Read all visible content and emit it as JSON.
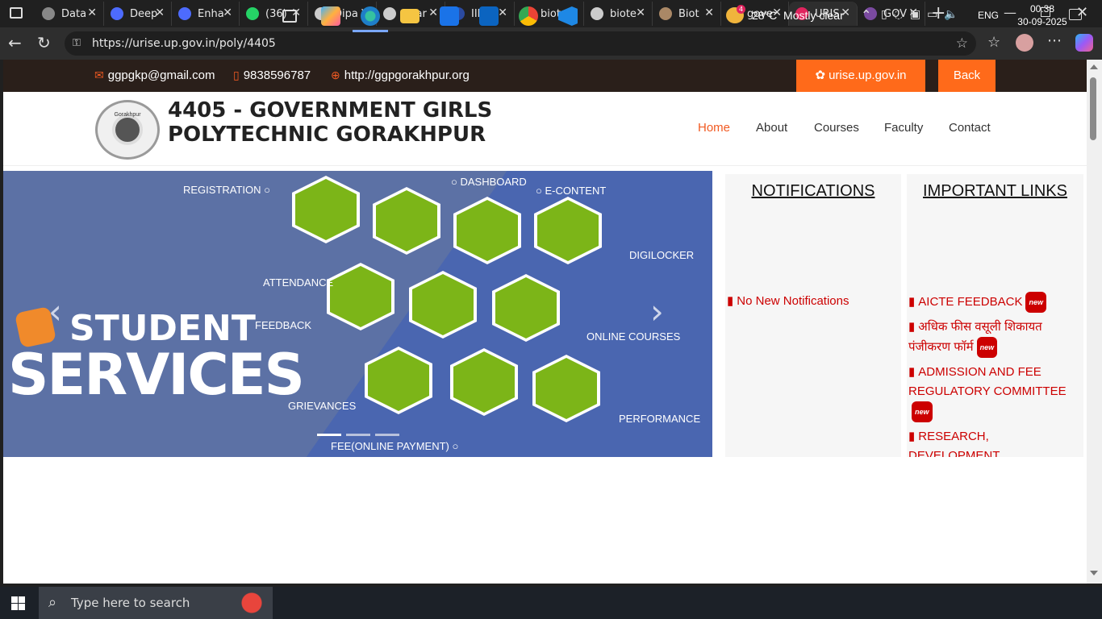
{
  "browser": {
    "tabs": [
      {
        "title": "Data",
        "icon": "openai-icon",
        "color": "#888"
      },
      {
        "title": "Deep",
        "icon": "deepseek-icon",
        "color": "#4d6bfe"
      },
      {
        "title": "Enha",
        "icon": "deepseek-icon",
        "color": "#4d6bfe"
      },
      {
        "title": "(36)",
        "icon": "whatsapp-icon",
        "color": "#25d366"
      },
      {
        "title": "Dipa",
        "icon": "globe-icon",
        "color": "#ccc"
      },
      {
        "title": "Shar",
        "icon": "globe-icon",
        "color": "#ccc"
      },
      {
        "title": "IIMM",
        "icon": "site-logo-icon",
        "color": "#2b4aa0"
      },
      {
        "title": "biote",
        "icon": "search-icon",
        "color": "#4aa3ff"
      },
      {
        "title": "biote",
        "icon": "globe-icon",
        "color": "#ccc"
      },
      {
        "title": "Biot",
        "icon": "emblem-icon",
        "color": "#aa8866"
      },
      {
        "title": "gove",
        "icon": "search-icon",
        "color": "#4aa3ff"
      },
      {
        "title": "URIS",
        "icon": "urise-icon",
        "color": "#e0245e"
      },
      {
        "title": "GOV",
        "icon": "site-logo-icon",
        "color": "#7a4aa0"
      }
    ],
    "url": "https://urise.up.gov.in/poly/4405"
  },
  "topstrip": {
    "email": "ggpgkp@gmail.com",
    "phone": "9838596787",
    "website": "http://ggpgorakhpur.org",
    "urise_button": "urise.up.gov.in",
    "back_button": "Back"
  },
  "header": {
    "title": "4405 - GOVERNMENT GIRLS POLYTECHNIC GORAKHPUR",
    "logo_text": "Gorakhpur",
    "nav": [
      "Home",
      "About",
      "Courses",
      "Faculty",
      "Contact"
    ]
  },
  "slider": {
    "headline1": "STUDENT",
    "headline2": "SERVICES",
    "labels": {
      "registration": "REGISTRATION",
      "dashboard": "DASHBOARD",
      "econtent": "E-CONTENT",
      "digilocker": "DIGILOCKER",
      "attendance": "ATTENDANCE",
      "feedback": "FEEDBACK",
      "online_courses": "ONLINE COURSES",
      "grievances": "GRIEVANCES",
      "performance": "PERFORMANCE",
      "fee": "FEE(ONLINE PAYMENT)"
    },
    "prev": "‹",
    "next": "›"
  },
  "notifications": {
    "heading": "NOTIFICATIONS",
    "empty": "No New Notifications"
  },
  "important_links": {
    "heading": "IMPORTANT LINKS",
    "items": [
      {
        "label": "AICTE FEEDBACK",
        "new": "new"
      },
      {
        "label": "अधिक फीस वसूली शिकायत पंजीकरण फॉर्म",
        "new": "new"
      },
      {
        "label": "ADMISSION AND FEE REGULATORY COMMITTEE",
        "new": "new"
      },
      {
        "label": "RESEARCH, DEVELOPMENT"
      }
    ]
  },
  "taskbar": {
    "search_placeholder": "Type here to search",
    "weather": "28°C  Mostly clear",
    "weather_badge": "4",
    "lang": "ENG",
    "time": "00:38",
    "date": "30-09-2025"
  }
}
